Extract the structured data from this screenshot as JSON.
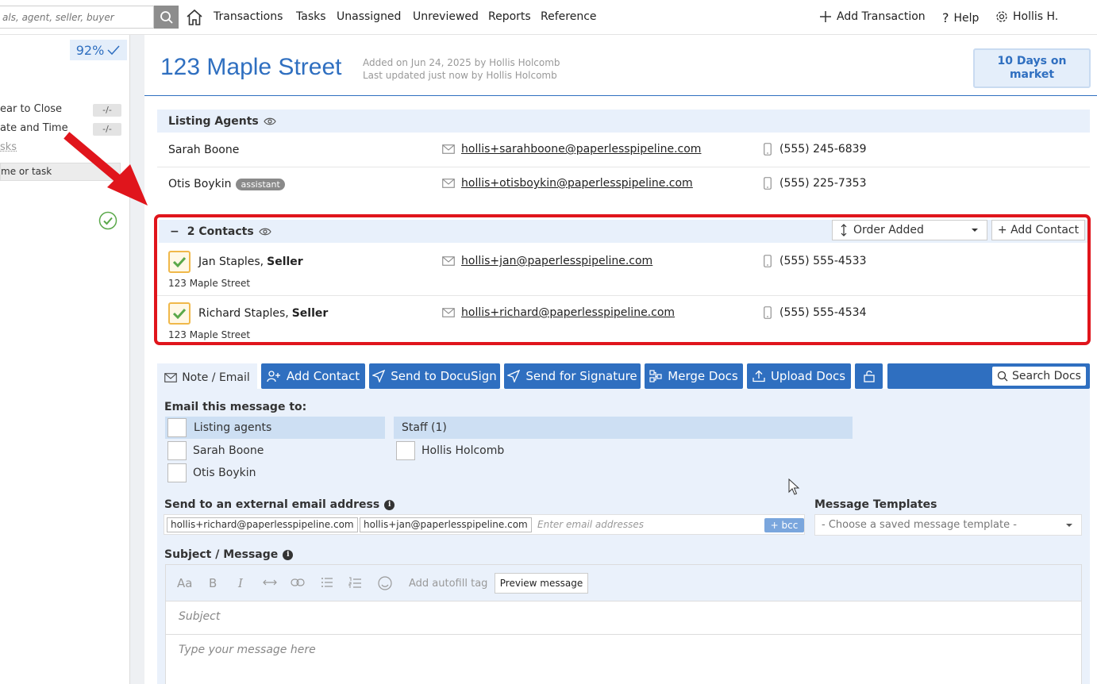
{
  "topnav": {
    "search_placeholder": "als, agent, seller, buyer",
    "links": [
      "Transactions",
      "Tasks",
      "Unassigned",
      "Unreviewed",
      "Reports",
      "Reference"
    ],
    "add_transaction": "Add Transaction",
    "help": "Help",
    "user": "Hollis H."
  },
  "sidebar": {
    "progress": "92%",
    "rows": [
      {
        "label": "ear to Close",
        "value": "-/-"
      },
      {
        "label": "ate and Time",
        "value": "-/-"
      }
    ],
    "tasks_link": "sks",
    "filter_placeholder": "me or task"
  },
  "header": {
    "title": "123 Maple Street",
    "added": "Added on Jun 24, 2025 by Hollis Holcomb",
    "updated": "Last updated just now by Hollis Holcomb",
    "days_badge": "10 Days on market"
  },
  "listing_agents": {
    "heading": "Listing Agents",
    "people": [
      {
        "name": "Sarah Boone",
        "tag": "",
        "email": "hollis+sarahboone@paperlesspipeline.com",
        "phone": "(555) 245-6839"
      },
      {
        "name": "Otis Boykin",
        "tag": "assistant",
        "email": "hollis+otisboykin@paperlesspipeline.com",
        "phone": "(555) 225-7353"
      }
    ]
  },
  "contacts": {
    "collapse": "−",
    "heading": "2 Contacts",
    "order_label": "Order Added",
    "add_button": "+ Add Contact",
    "people": [
      {
        "name": "Jan Staples, ",
        "role": "Seller",
        "address": "123 Maple Street",
        "email": "hollis+jan@paperlesspipeline.com",
        "phone": "(555) 555-4533"
      },
      {
        "name": "Richard Staples, ",
        "role": "Seller",
        "address": "123 Maple Street",
        "email": "hollis+richard@paperlesspipeline.com",
        "phone": "(555) 555-4534"
      }
    ]
  },
  "toolbar": {
    "note_tab": "Note / Email",
    "add_contact": "Add Contact",
    "send_docusign": "Send to DocuSign",
    "send_signature": "Send for Signature",
    "merge_docs": "Merge Docs",
    "upload_docs": "Upload Docs",
    "search_docs": "Search Docs"
  },
  "compose": {
    "email_to_label": "Email this message to:",
    "listing_agents_group": "Listing agents",
    "staff_group": "Staff (1)",
    "recipients_agents": [
      "Sarah Boone",
      "Otis Boykin"
    ],
    "recipients_staff": [
      "Hollis Holcomb"
    ],
    "external_label": "Send to an external email address",
    "external_tokens": [
      "hollis+richard@paperlesspipeline.com",
      "hollis+jan@paperlesspipeline.com"
    ],
    "external_placeholder": "Enter email addresses",
    "bcc": "+ bcc",
    "templates_label": "Message Templates",
    "templates_placeholder": "- Choose a saved message template -",
    "subject_label": "Subject / Message",
    "autofill": "Add autofill tag",
    "preview": "Preview message",
    "subject_placeholder": "Subject",
    "message_placeholder": "Type your message here",
    "font_icon": "Aa",
    "bold_icon": "B",
    "italic_icon": "I"
  },
  "colors": {
    "brand_blue": "#2f6fc0",
    "highlight_red": "#e0151c",
    "section_bg": "#e8f0fb"
  }
}
